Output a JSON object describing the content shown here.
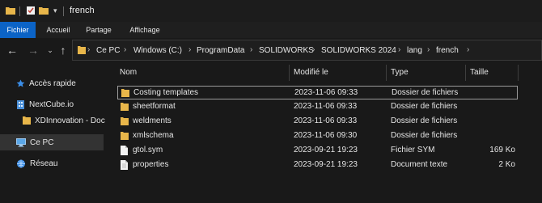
{
  "window": {
    "title": "french"
  },
  "ribbon": {
    "tabs": [
      {
        "label": "Fichier",
        "active": true
      },
      {
        "label": "Accueil",
        "active": false
      },
      {
        "label": "Partage",
        "active": false
      },
      {
        "label": "Affichage",
        "active": false
      }
    ]
  },
  "address": {
    "crumbs": [
      "Ce PC",
      "Windows (C:)",
      "ProgramData",
      "SOLIDWORKS",
      "SOLIDWORKS 2024",
      "lang",
      "french"
    ]
  },
  "nav": {
    "items": [
      {
        "label": "Accès rapide",
        "icon": "star-icon"
      },
      {
        "label": "NextCube.io",
        "icon": "building-icon"
      },
      {
        "label": "XDInnovation - Doc",
        "icon": "folder-icon"
      },
      {
        "label": "Ce PC",
        "icon": "computer-icon",
        "selected": true
      },
      {
        "label": "Réseau",
        "icon": "network-icon"
      }
    ]
  },
  "list": {
    "columns": {
      "name": "Nom",
      "modified": "Modifié le",
      "type": "Type",
      "size": "Taille"
    },
    "rows": [
      {
        "name": "Costing templates",
        "modified": "2023-11-06 09:33",
        "type": "Dossier de fichiers",
        "size": "",
        "icon": "folder-icon"
      },
      {
        "name": "sheetformat",
        "modified": "2023-11-06 09:33",
        "type": "Dossier de fichiers",
        "size": "",
        "icon": "folder-icon"
      },
      {
        "name": "weldments",
        "modified": "2023-11-06 09:33",
        "type": "Dossier de fichiers",
        "size": "",
        "icon": "folder-icon"
      },
      {
        "name": "xmlschema",
        "modified": "2023-11-06 09:30",
        "type": "Dossier de fichiers",
        "size": "",
        "icon": "folder-icon"
      },
      {
        "name": "gtol.sym",
        "modified": "2023-09-21 19:23",
        "type": "Fichier SYM",
        "size": "169 Ko",
        "icon": "file-icon"
      },
      {
        "name": "properties",
        "modified": "2023-09-21 19:23",
        "type": "Document texte",
        "size": "2 Ko",
        "icon": "text-file-icon"
      }
    ]
  },
  "colors": {
    "accent": "#0b63c6",
    "folder": "#e8b64a",
    "background": "#191919"
  }
}
